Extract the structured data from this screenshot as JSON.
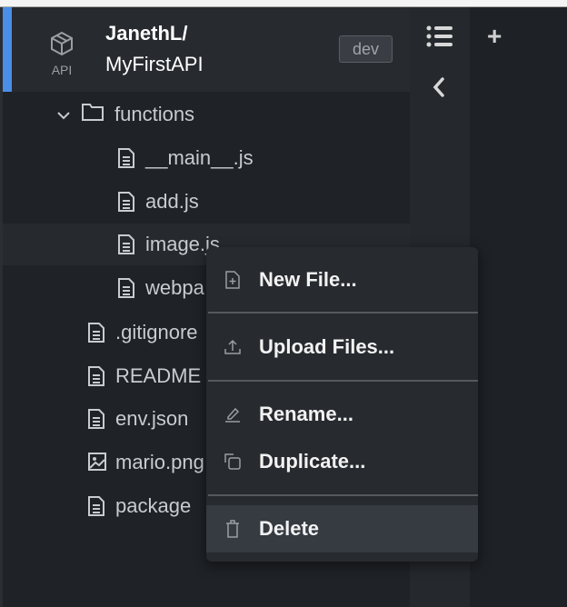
{
  "project": {
    "type_label": "API",
    "owner": "JanethL/",
    "name": "MyFirstAPI",
    "env_badge": "dev"
  },
  "tree": [
    {
      "name": "functions",
      "type": "folder",
      "depth": 0,
      "expanded": true
    },
    {
      "name": "__main__.js",
      "type": "file",
      "depth": 1
    },
    {
      "name": "add.js",
      "type": "file",
      "depth": 1
    },
    {
      "name": "image.js",
      "type": "file",
      "depth": 1,
      "hovered": true
    },
    {
      "name": "webpa",
      "type": "file",
      "depth": 1
    },
    {
      "name": ".gitignore",
      "type": "file",
      "depth": 0
    },
    {
      "name": "README",
      "type": "file",
      "depth": 0
    },
    {
      "name": "env.json",
      "type": "file",
      "depth": 0
    },
    {
      "name": "mario.png",
      "type": "image",
      "depth": 0
    },
    {
      "name": "package",
      "type": "file",
      "depth": 0
    }
  ],
  "context_menu": {
    "new_file": "New File...",
    "upload": "Upload Files...",
    "rename": "Rename...",
    "duplicate": "Duplicate...",
    "delete": "Delete"
  },
  "colors": {
    "accent": "#4a8ee8",
    "background": "#1f2226",
    "menu": "#272a2f"
  }
}
